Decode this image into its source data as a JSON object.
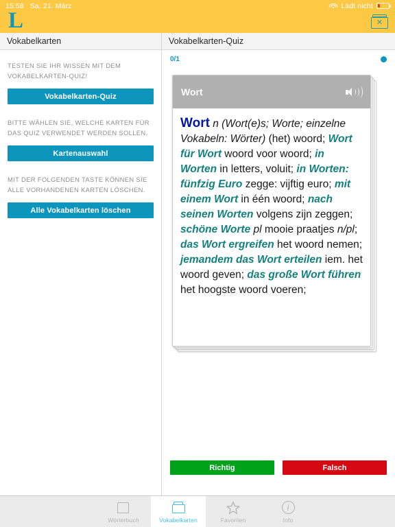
{
  "statusbar": {
    "time": "15:58",
    "date": "Sa. 21. März",
    "battery_label": "Lädt nicht",
    "wifi_icon": "wifi-icon",
    "battery_icon": "battery-icon"
  },
  "appbar": {
    "logo": "L",
    "delete_card_icon": "card-delete-icon",
    "delete_card_glyph": "✕",
    "background_color": "#fdc944"
  },
  "left_pane": {
    "title": "Vokabelkarten",
    "hint_quiz": "TESTEN SIE IHR WISSEN MIT DEM VOKABELKARTEN-QUIZ!",
    "btn_quiz": "Vokabelkarten-Quiz",
    "hint_select": "BITTE WÄHLEN SIE, WELCHE KARTEN FÜR DAS QUIZ VERWENDET WERDEN SOLLEN.",
    "btn_selection": "Kartenauswahl",
    "hint_delete": "MIT DER FOLGENDEN TASTE KÖNNEN SIE ALLE VORHANDENEN KARTEN LÖSCHEN.",
    "btn_delete_all": "Alle Vokabelkarten löschen",
    "accent_color": "#0d96bd"
  },
  "right_pane": {
    "title": "Vokabelkarten-Quiz",
    "counter": "0/1",
    "indicator_color": "#0d96bd",
    "card": {
      "header_title": "Wort",
      "speaker_icon": "speaker-icon",
      "entry": {
        "headword": "Wort",
        "grammar": " n (Wort(e)s; Worte; einzelne Vokabeln: Wörter) ",
        "translation_1": "(het) woord; ",
        "de_1": "Wort für Wort",
        "nl_1": " woord voor woord; ",
        "de_2": "in Worten",
        "nl_2": " in letters, voluit; ",
        "de_3": "in Worten: fünfzig Euro",
        "nl_3": " zegge: vijftig euro; ",
        "de_4": "mit einem Wort",
        "nl_4": " in één woord; ",
        "de_5": "nach seinen Worten",
        "nl_5": " volgens zijn zeggen; ",
        "de_6": "schöne Worte",
        "gram_6": " pl",
        "nl_6": " mooie praatjes ",
        "gram_6b": "n/pl",
        "nl_6c": "; ",
        "de_7": "das Wort ergreifen",
        "nl_7": " het woord nemen; ",
        "de_8": "jemandem das Wort erteilen",
        "nl_8": " iem. het woord geven; ",
        "de_9": "das große Wort führen",
        "nl_9": " het hoogste woord voeren;"
      }
    },
    "btn_correct": "Richtig",
    "btn_wrong": "Falsch",
    "correct_color": "#00a21c",
    "wrong_color": "#d60812"
  },
  "tabbar": {
    "tabs": [
      {
        "label": "Wörterbuch",
        "icon": "book-icon",
        "active": false
      },
      {
        "label": "Vokabelkarten",
        "icon": "cards-icon",
        "active": true
      },
      {
        "label": "Favoriten",
        "icon": "star-icon",
        "active": false
      },
      {
        "label": "Info",
        "icon": "info-icon",
        "active": false
      }
    ],
    "active_color": "#41c0e8"
  }
}
